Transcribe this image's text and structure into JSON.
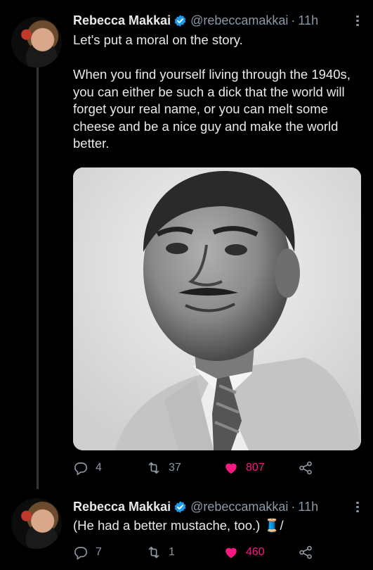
{
  "tweets": [
    {
      "author": {
        "name": "Rebecca Makkai",
        "handle": "@rebeccamakkai",
        "verified": true
      },
      "time": "11h",
      "text": "Let's put a moral on the story.\n\nWhen you find yourself living through the 1940s, you can either be such a dick that the world will forget your real name, or you can melt some cheese and be a nice guy and make the world better.",
      "media": {
        "type": "photo",
        "subject": "black-and-white portrait"
      },
      "metrics": {
        "replies": "4",
        "retweets": "37",
        "likes": "807"
      },
      "liked": true
    },
    {
      "author": {
        "name": "Rebecca Makkai",
        "handle": "@rebeccamakkai",
        "verified": true
      },
      "time": "11h",
      "text": "(He had a better mustache, too.) 🧵/",
      "metrics": {
        "replies": "7",
        "retweets": "1",
        "likes": "460"
      },
      "liked": true
    }
  ],
  "colors": {
    "background": "#000000",
    "text_primary": "#e7e9ea",
    "text_secondary": "#8b98a5",
    "verified": "#1d9bf0",
    "like": "#f91880"
  }
}
